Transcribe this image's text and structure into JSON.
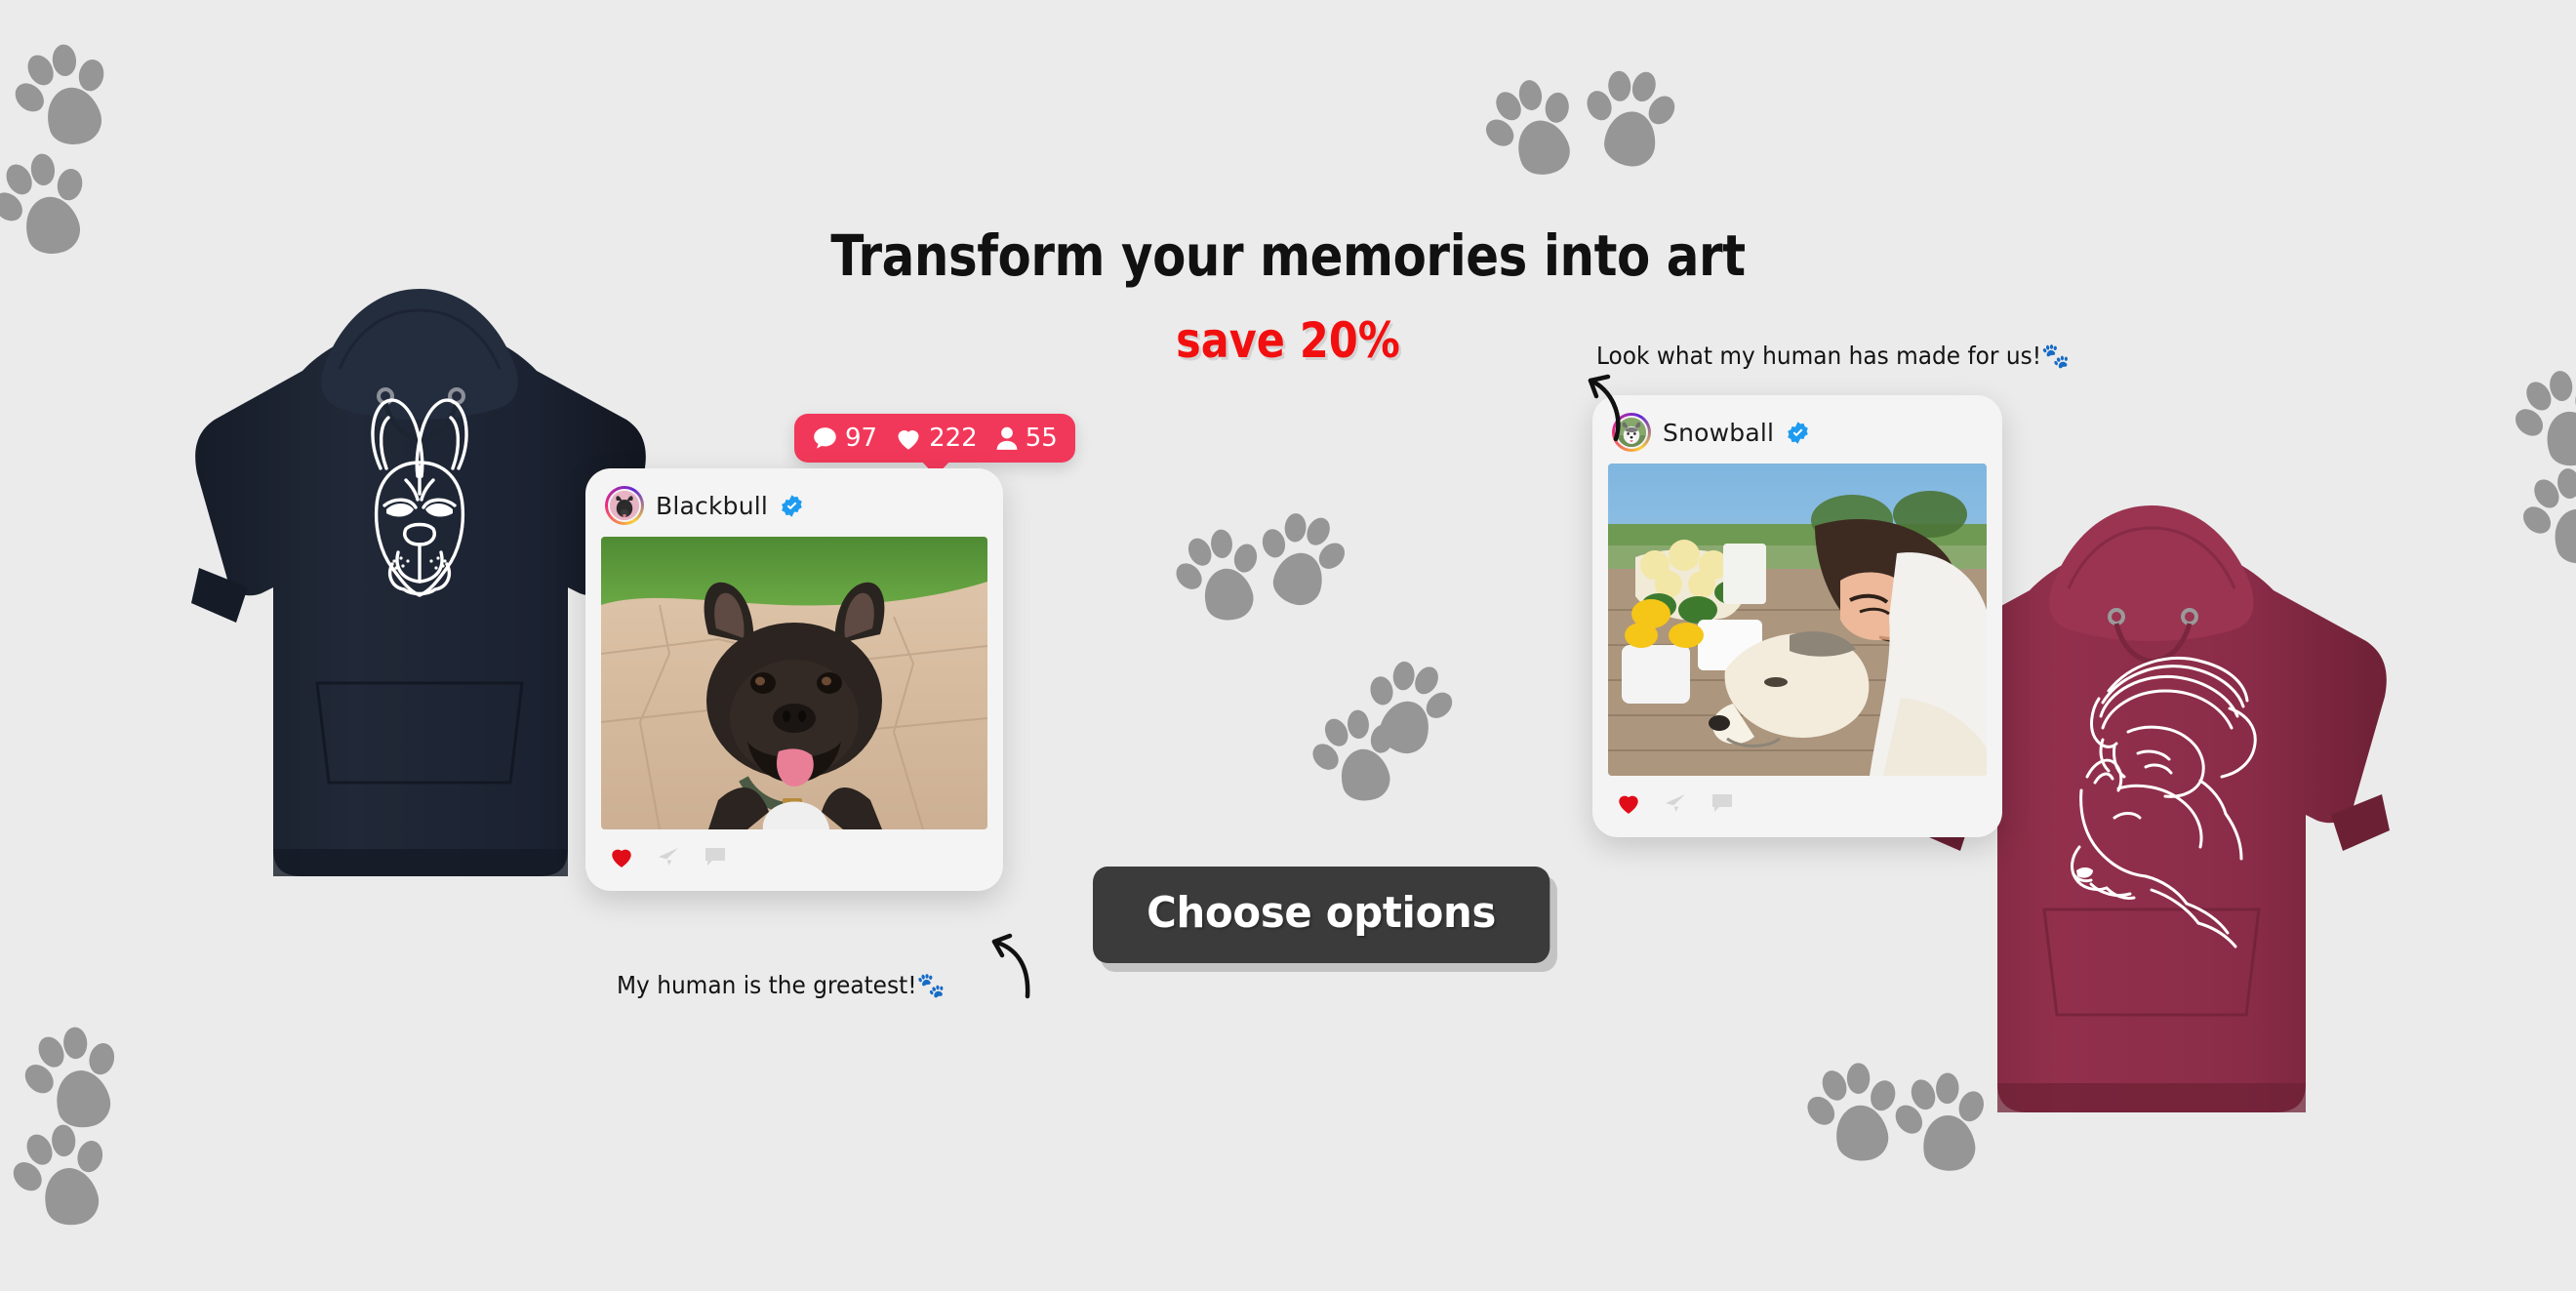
{
  "background_color": "#ebebeb",
  "headline": {
    "line1": "Transform your memories into art",
    "line2": "save 20%",
    "line1_color": "#111111",
    "line2_color": "#f20f0f"
  },
  "cta": {
    "label": "Choose options",
    "bg_color": "#3b3b3b",
    "text_color": "#ffffff"
  },
  "stats_bubble": {
    "bg_color": "#f2385a",
    "items": [
      {
        "icon": "comment-icon",
        "value": "97"
      },
      {
        "icon": "heart-icon",
        "value": "222"
      },
      {
        "icon": "person-icon",
        "value": "55"
      }
    ]
  },
  "cards": [
    {
      "id": "blackbull",
      "username": "Blackbull",
      "verified": true,
      "avatar_alt": "french-bulldog-avatar",
      "photo_alt": "black-french-bulldog-sitting-on-patio",
      "actions": [
        "heart-icon",
        "send-icon",
        "comment-icon"
      ],
      "caption": "My human is the greatest!🐾"
    },
    {
      "id": "snowball",
      "username": "Snowball",
      "verified": true,
      "avatar_alt": "husky-avatar",
      "photo_alt": "woman-kissing-husky-on-deck-with-flowers",
      "actions": [
        "heart-icon",
        "send-icon",
        "comment-icon"
      ],
      "caption": "Look what my human has made for us!🐾"
    }
  ],
  "products": [
    {
      "id": "navy-hoodie",
      "alt": "navy-hoodie-with-french-bulldog-line-art",
      "color": "#1d2433",
      "print_color": "#ffffff"
    },
    {
      "id": "maroon-hoodie",
      "alt": "maroon-hoodie-with-woman-and-dog-line-art",
      "color": "#8a2c48",
      "print_color": "#ffffff"
    }
  ],
  "decor": {
    "paw_color": "#969696",
    "paw_count": 16
  }
}
